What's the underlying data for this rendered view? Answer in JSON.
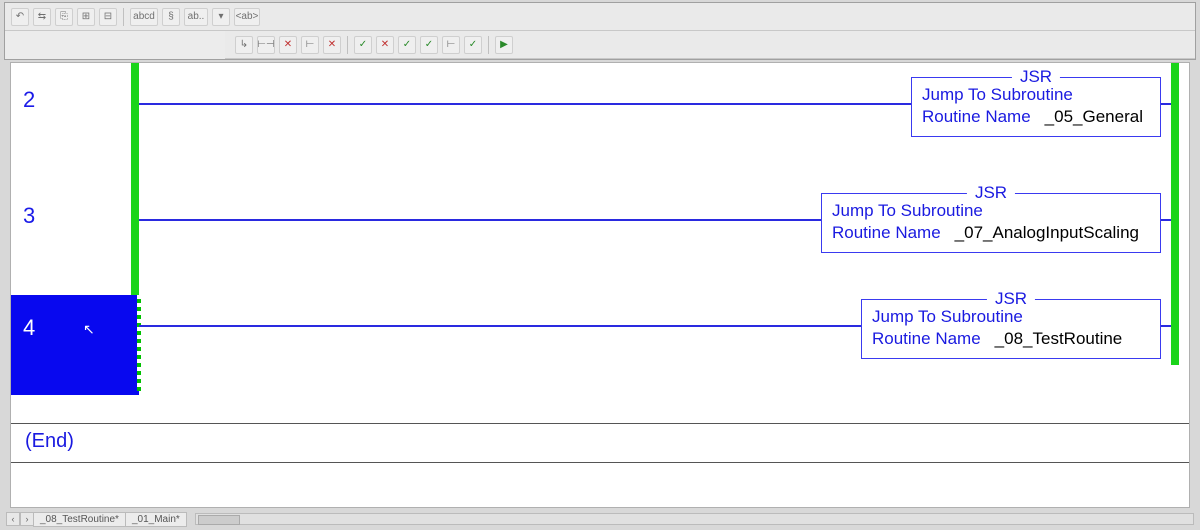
{
  "toolbar_icons_1": [
    "↶",
    "⇆",
    "⎘",
    "⊞",
    "⊟",
    "abcd",
    "§",
    "ab..",
    "▾",
    "<ab>"
  ],
  "toolbar_icons_2": [
    "↳",
    "⊢⊣",
    "✕",
    "⊢",
    "✕",
    "✓",
    "✕",
    "✓",
    "✓",
    "⊢",
    "✓",
    "",
    "▶"
  ],
  "rungs": [
    {
      "number": "2",
      "selected": false,
      "instruction": {
        "mnemonic": "JSR",
        "description": "Jump To Subroutine",
        "param_label": "Routine Name",
        "param_value": "_05_General"
      }
    },
    {
      "number": "3",
      "selected": false,
      "instruction": {
        "mnemonic": "JSR",
        "description": "Jump To Subroutine",
        "param_label": "Routine Name",
        "param_value": "_07_AnalogInputScaling"
      }
    },
    {
      "number": "4",
      "selected": true,
      "instruction": {
        "mnemonic": "JSR",
        "description": "Jump To Subroutine",
        "param_label": "Routine Name",
        "param_value": "_08_TestRoutine"
      }
    }
  ],
  "end_label": "(End)",
  "tabs": [
    "_08_TestRoutine*",
    "_01_Main*"
  ],
  "tab_prev": "‹",
  "tab_next": "›"
}
